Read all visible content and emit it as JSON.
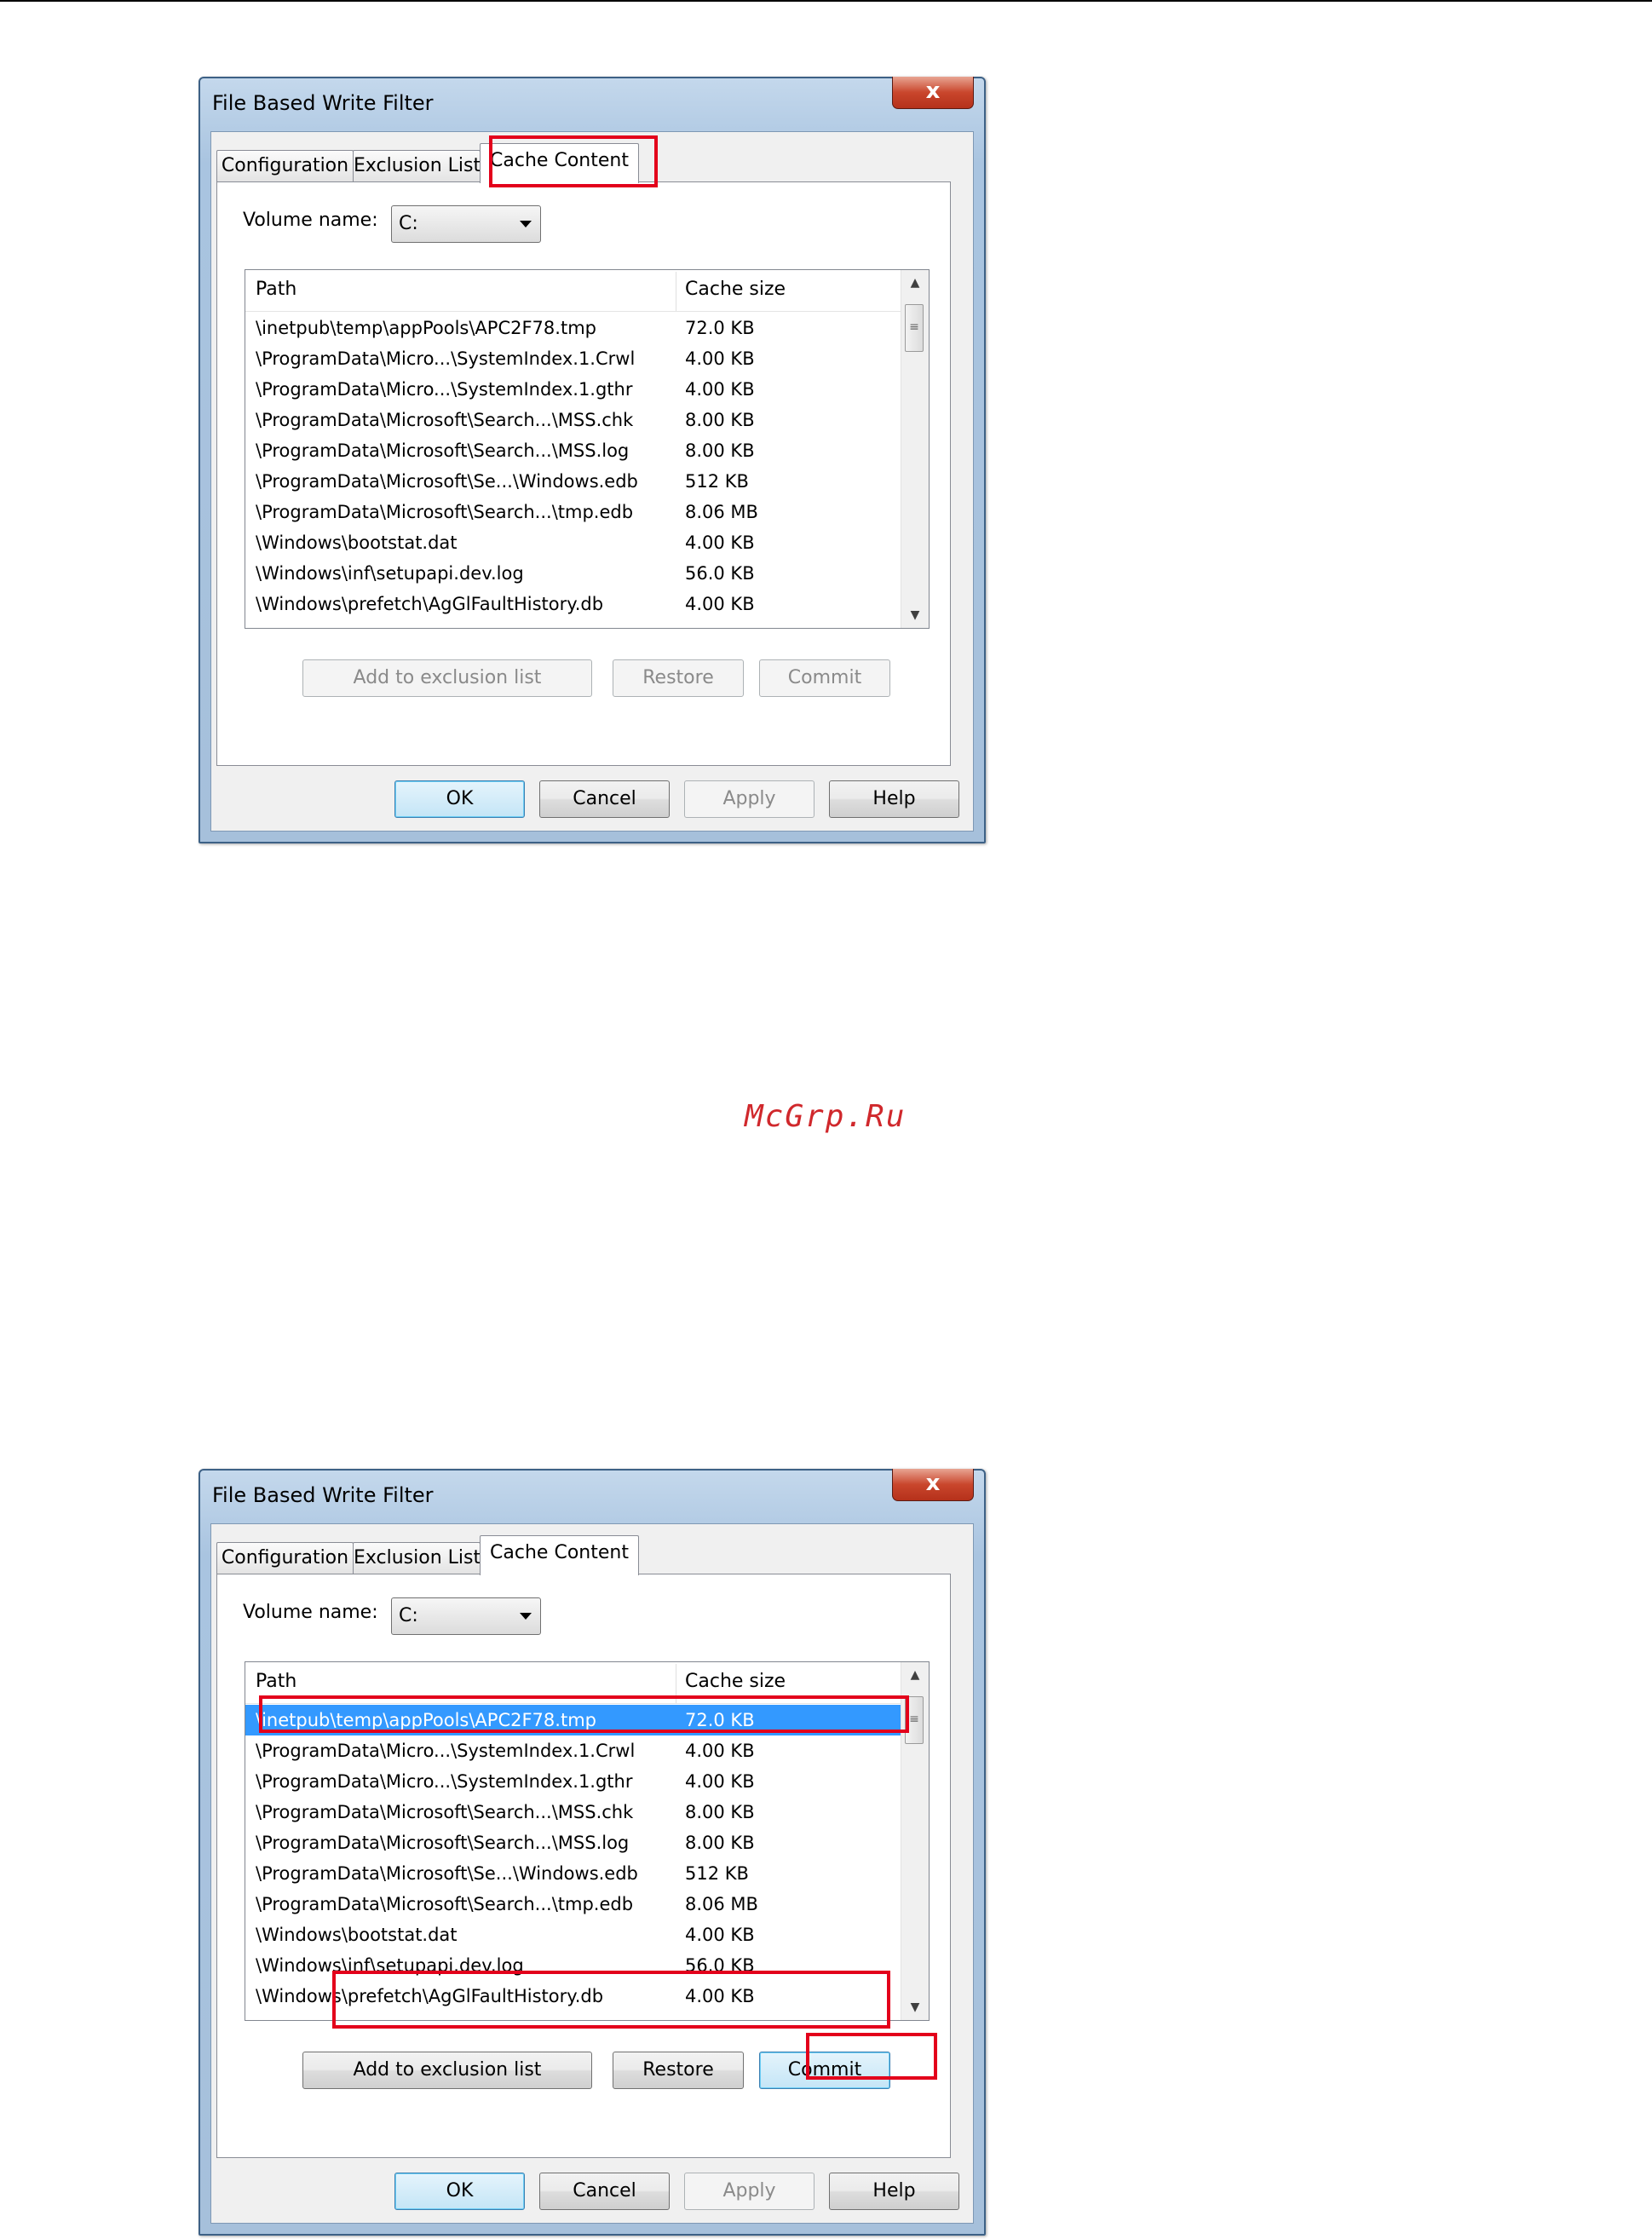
{
  "watermark": "McGrp.Ru",
  "colors": {
    "selection": "#3399ff",
    "highlight": "#e3001b",
    "watermark": "#d0282c",
    "title_bar": "#a9c4e0"
  },
  "dialog1": {
    "title": "File Based Write Filter",
    "close_glyph": "x",
    "tabs": {
      "configuration": "Configuration",
      "exclusion_list": "Exclusion List",
      "cache_content": "Cache Content"
    },
    "active_tab": "Cache Content",
    "volume_label": "Volume name:",
    "volume_value": "C:",
    "columns": {
      "path": "Path",
      "size": "Cache size"
    },
    "rows": [
      {
        "path": "\\inetpub\\temp\\appPools\\APC2F78.tmp",
        "size": "72.0 KB"
      },
      {
        "path": "\\ProgramData\\Micro...\\SystemIndex.1.Crwl",
        "size": "4.00 KB"
      },
      {
        "path": "\\ProgramData\\Micro...\\SystemIndex.1.gthr",
        "size": "4.00 KB"
      },
      {
        "path": "\\ProgramData\\Microsoft\\Search...\\MSS.chk",
        "size": "8.00 KB"
      },
      {
        "path": "\\ProgramData\\Microsoft\\Search...\\MSS.log",
        "size": "8.00 KB"
      },
      {
        "path": "\\ProgramData\\Microsoft\\Se...\\Windows.edb",
        "size": "512 KB"
      },
      {
        "path": "\\ProgramData\\Microsoft\\Search...\\tmp.edb",
        "size": "8.06 MB"
      },
      {
        "path": "\\Windows\\bootstat.dat",
        "size": "4.00 KB"
      },
      {
        "path": "\\Windows\\inf\\setupapi.dev.log",
        "size": "56.0 KB"
      },
      {
        "path": "\\Windows\\prefetch\\AgGlFaultHistory.db",
        "size": "4.00 KB"
      }
    ],
    "buttons": {
      "add": "Add to exclusion list",
      "restore": "Restore",
      "commit": "Commit",
      "ok": "OK",
      "cancel": "Cancel",
      "apply": "Apply",
      "help": "Help"
    }
  },
  "dialog2": {
    "title": "File Based Write Filter",
    "close_glyph": "x",
    "tabs": {
      "configuration": "Configuration",
      "exclusion_list": "Exclusion List",
      "cache_content": "Cache Content"
    },
    "active_tab": "Cache Content",
    "volume_label": "Volume name:",
    "volume_value": "C:",
    "columns": {
      "path": "Path",
      "size": "Cache size"
    },
    "selected_row": 0,
    "rows": [
      {
        "path": "\\inetpub\\temp\\appPools\\APC2F78.tmp",
        "size": "72.0 KB"
      },
      {
        "path": "\\ProgramData\\Micro...\\SystemIndex.1.Crwl",
        "size": "4.00 KB"
      },
      {
        "path": "\\ProgramData\\Micro...\\SystemIndex.1.gthr",
        "size": "4.00 KB"
      },
      {
        "path": "\\ProgramData\\Microsoft\\Search...\\MSS.chk",
        "size": "8.00 KB"
      },
      {
        "path": "\\ProgramData\\Microsoft\\Search...\\MSS.log",
        "size": "8.00 KB"
      },
      {
        "path": "\\ProgramData\\Microsoft\\Se...\\Windows.edb",
        "size": "512 KB"
      },
      {
        "path": "\\ProgramData\\Microsoft\\Search...\\tmp.edb",
        "size": "8.06 MB"
      },
      {
        "path": "\\Windows\\bootstat.dat",
        "size": "4.00 KB"
      },
      {
        "path": "\\Windows\\inf\\setupapi.dev.log",
        "size": "56.0 KB"
      },
      {
        "path": "\\Windows\\prefetch\\AgGlFaultHistory.db",
        "size": "4.00 KB"
      }
    ],
    "buttons": {
      "add": "Add to exclusion list",
      "restore": "Restore",
      "commit": "Commit",
      "ok": "OK",
      "cancel": "Cancel",
      "apply": "Apply",
      "help": "Help"
    }
  }
}
